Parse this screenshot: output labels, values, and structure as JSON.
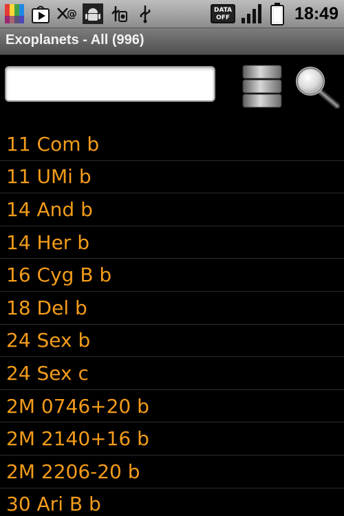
{
  "status_bar": {
    "icons": [
      "avg-antivirus-icon",
      "play-store-icon",
      "email-icon",
      "android-debug-icon",
      "usb-debug-icon",
      "usb-icon"
    ],
    "data_label_top": "DATA",
    "data_label_bottom": "OFF",
    "signal_icon": "signal-bars-icon",
    "battery_icon": "battery-icon",
    "time": "18:49"
  },
  "title_bar": {
    "title": "Exoplanets - All (996)"
  },
  "search": {
    "value": "",
    "placeholder": "",
    "database_icon": "database-icon",
    "search_icon": "magnifier-icon"
  },
  "colors": {
    "item_text": "#f39c1a",
    "background": "#000000"
  },
  "planets": [
    "11 Com b",
    "11 UMi b",
    "14 And b",
    "14 Her b",
    "16 Cyg B b",
    "18 Del b",
    "24 Sex b",
    "24 Sex c",
    "2M 0746+20 b",
    "2M 2140+16 b",
    "2M 2206-20 b",
    "30 Ari B b"
  ]
}
